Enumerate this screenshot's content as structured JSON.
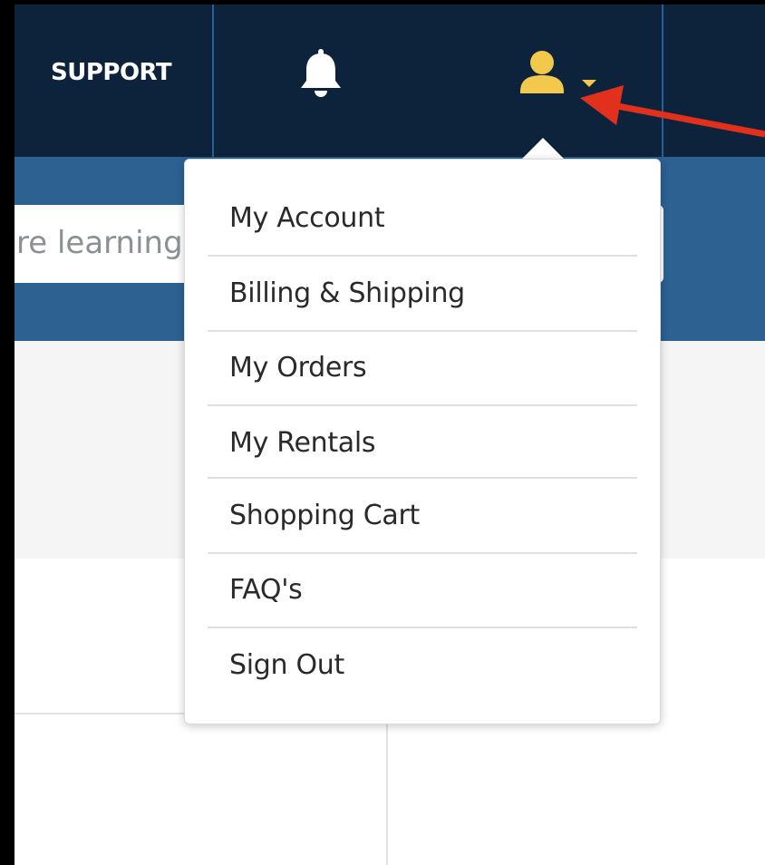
{
  "header": {
    "support_label": "SUPPORT"
  },
  "search": {
    "visible_text": "re learning"
  },
  "icons": {
    "bell": "bell-icon",
    "user": "user-icon",
    "caret": "caret-down-icon"
  },
  "account_menu": {
    "items": [
      {
        "label": "My Account"
      },
      {
        "label": "Billing & Shipping"
      },
      {
        "label": "My Orders"
      },
      {
        "label": "My Rentals"
      },
      {
        "label": "Shopping Cart"
      },
      {
        "label": "FAQ's"
      },
      {
        "label": "Sign Out"
      }
    ]
  },
  "colors": {
    "nav_background": "#0c233b",
    "secondary_bar": "#2c6192",
    "user_icon": "#f2c94c",
    "annotation_arrow": "#e1301b"
  }
}
